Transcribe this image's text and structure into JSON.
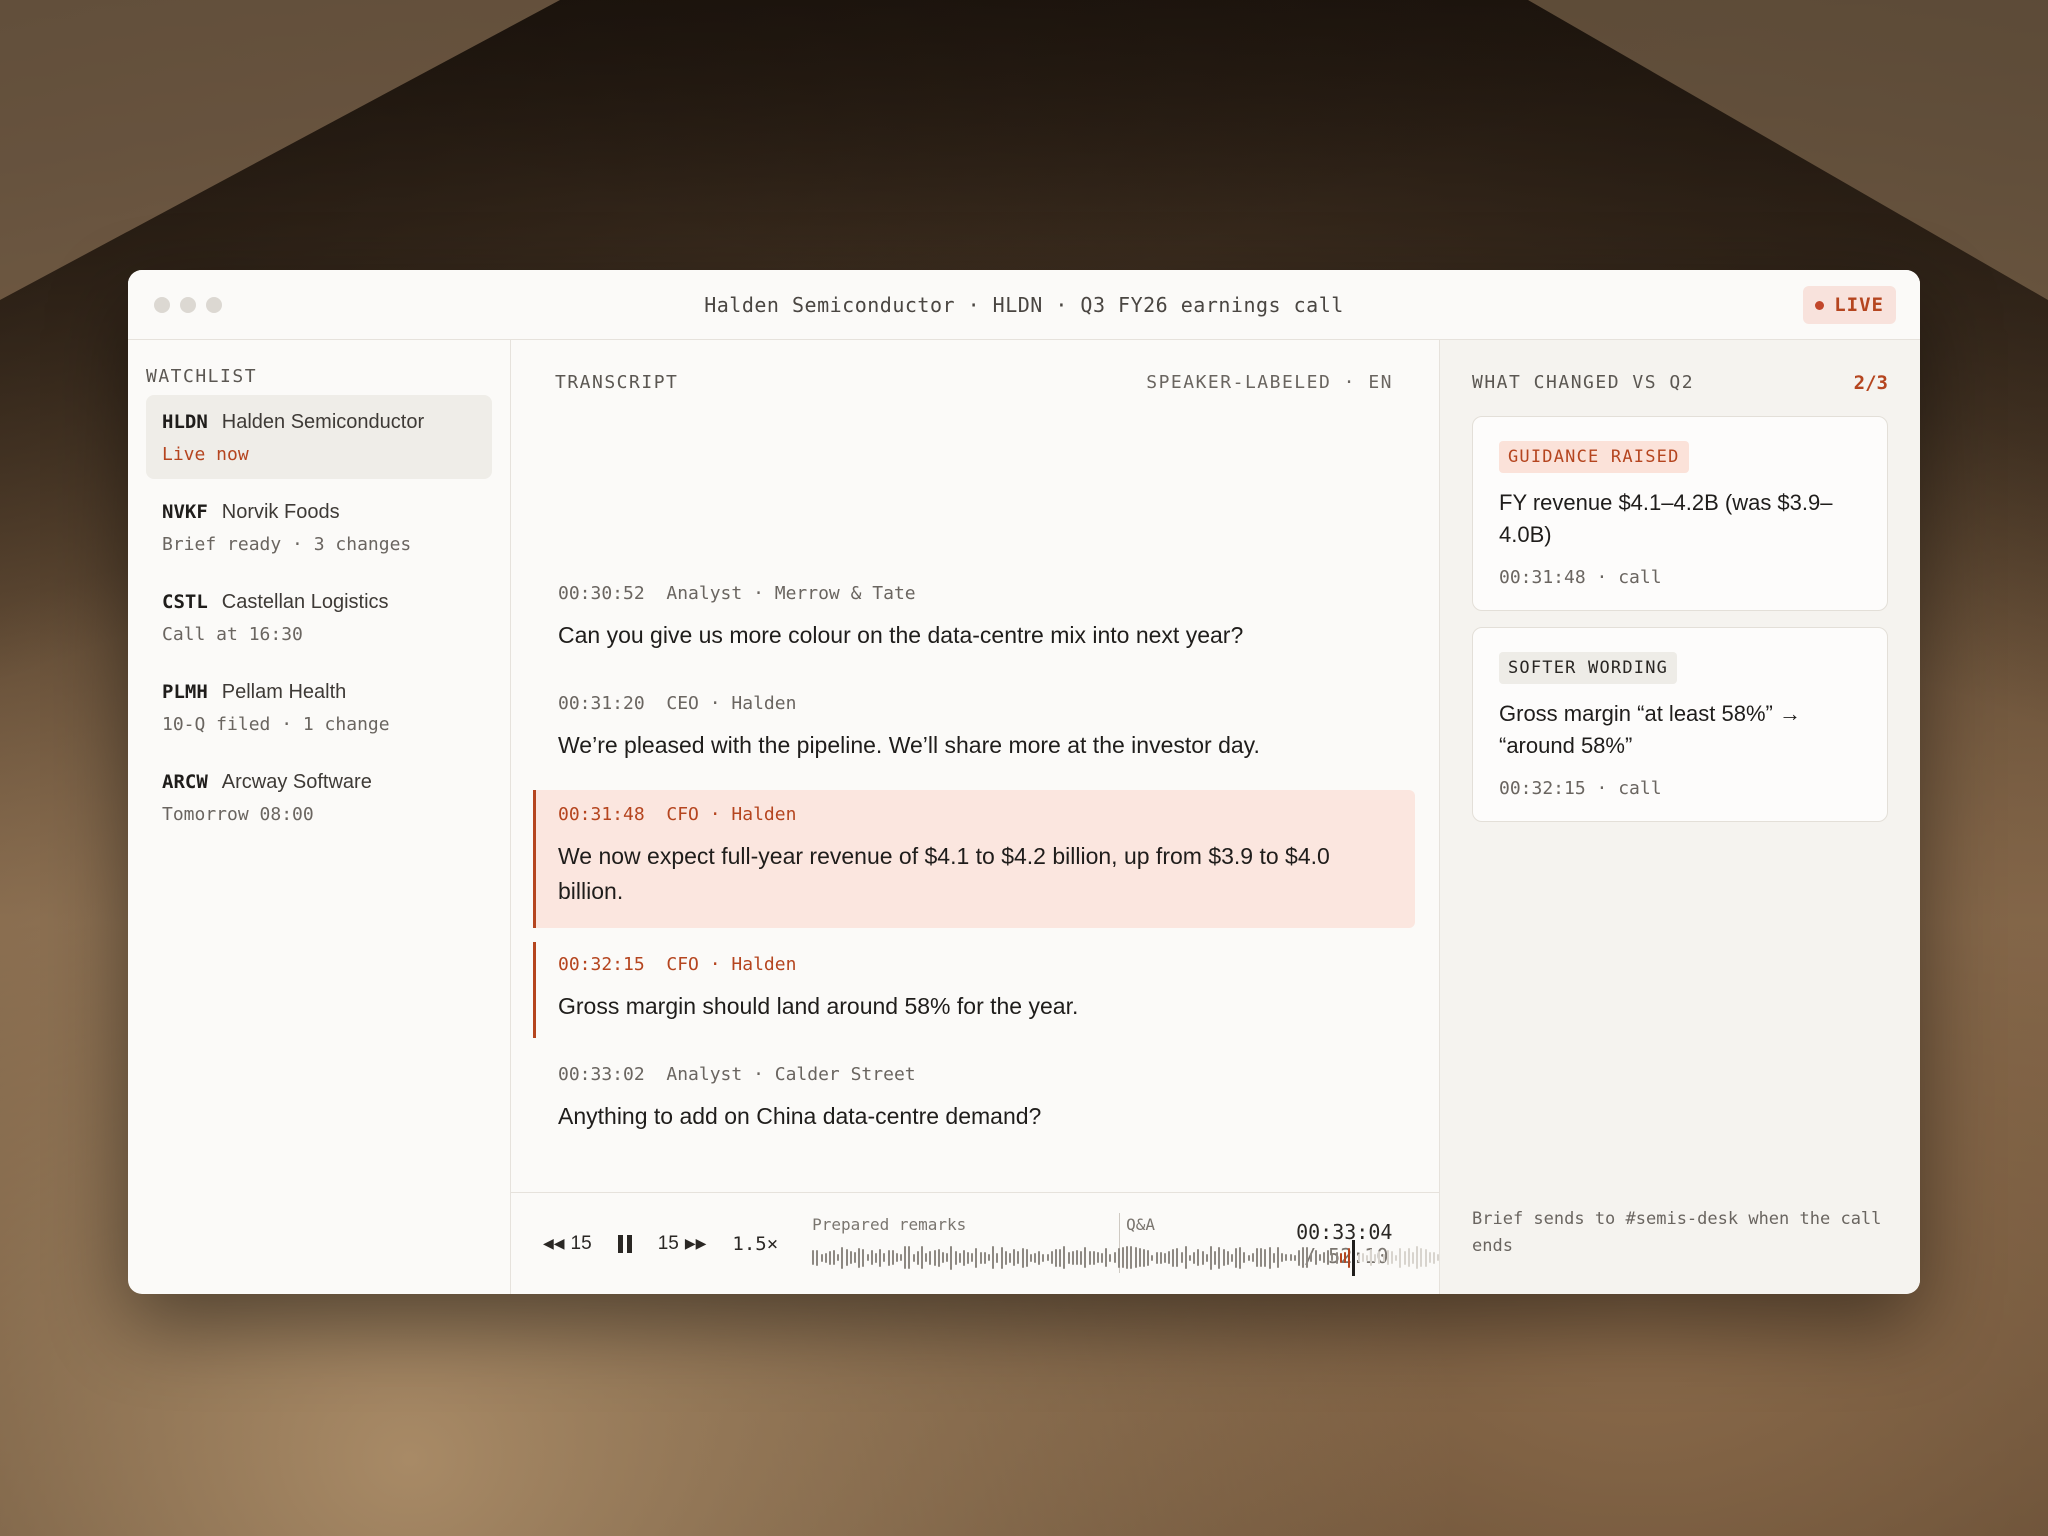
{
  "window": {
    "title": "Halden Semiconductor · HLDN · Q3 FY26 earnings call",
    "live_label": "LIVE"
  },
  "watchlist": {
    "label": "WATCHLIST",
    "items": [
      {
        "ticker": "HLDN",
        "name": "Halden Semiconductor",
        "status": "Live now"
      },
      {
        "ticker": "NVKF",
        "name": "Norvik Foods",
        "status": "Brief ready · 3 changes"
      },
      {
        "ticker": "CSTL",
        "name": "Castellan Logistics",
        "status": "Call at 16:30"
      },
      {
        "ticker": "PLMH",
        "name": "Pellam Health",
        "status": "10-Q filed · 1 change"
      },
      {
        "ticker": "ARCW",
        "name": "Arcway Software",
        "status": "Tomorrow 08:00"
      }
    ]
  },
  "transcript": {
    "label": "TRANSCRIPT",
    "mode": "SPEAKER-LABELED · EN",
    "utterances": [
      {
        "meta": "00:30:52  Analyst · Merrow & Tate",
        "text": "Can you give us more colour on the data-centre mix into next year?"
      },
      {
        "meta": "00:31:20  CEO · Halden",
        "text": "We’re pleased with the pipeline. We’ll share more at the investor day."
      },
      {
        "meta": "00:31:48  CFO · Halden",
        "text": "We now expect full-year revenue of $4.1 to $4.2 billion, up from $3.9 to $4.0 billion."
      },
      {
        "meta": "00:32:15  CFO · Halden",
        "text": "Gross margin should land around 58% for the year."
      },
      {
        "meta": "00:33:02  Analyst · Calder Street",
        "text": "Anything to add on China data-centre demand?"
      }
    ]
  },
  "player": {
    "rewind_label": "15",
    "forward_label": "15",
    "speed": "1.5×",
    "segment_prepared": "Prepared remarks",
    "segment_qa": "Q&A",
    "current_time": "00:33:04",
    "total_time": "/ 52:10",
    "progress_fraction": 0.634
  },
  "changes": {
    "label": "WHAT CHANGED VS Q2",
    "count": "2/3",
    "cards": [
      {
        "tag": "GUIDANCE RAISED",
        "desc": "FY revenue $4.1–4.2B (was $3.9–4.0B)",
        "meta": "00:31:48 · call"
      },
      {
        "tag": "SOFTER WORDING",
        "desc": "Gross margin “at least 58%” → “around 58%”",
        "meta": "00:32:15 · call"
      }
    ],
    "footnote": "Brief sends to #semis-desk when the call ends"
  },
  "colors": {
    "accent": "#b5451f",
    "highlight_bg": "#fbe6df"
  }
}
